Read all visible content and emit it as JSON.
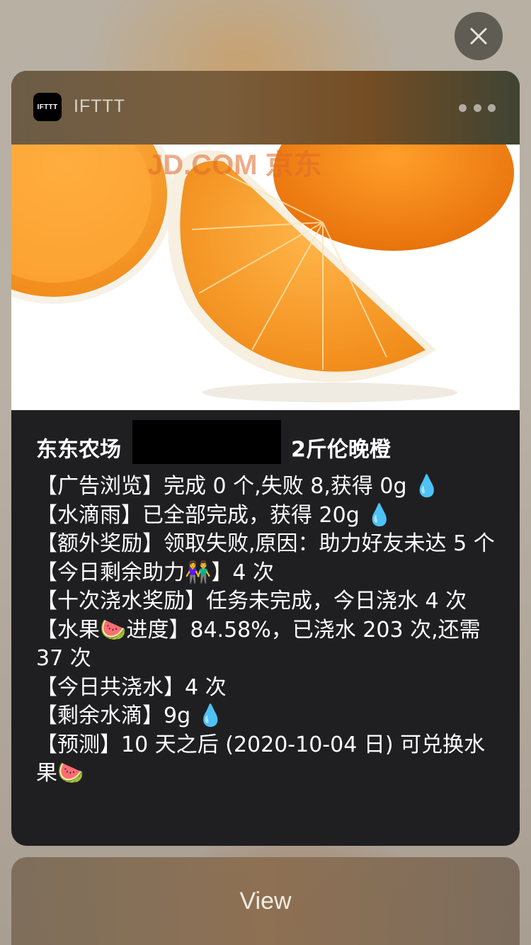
{
  "notification": {
    "app_icon_text": "IFTTT",
    "app_name": "IFTTT",
    "image_watermark": "JD.COM 京东",
    "title_prefix": "东东农场",
    "title_suffix": "2斤伦晚橙",
    "lines": [
      "【广告浏览】完成 0 个,失败 8,获得 0g 💧",
      "【水滴雨】已全部完成，获得 20g 💧",
      "【额外奖励】领取失败,原因：助力好友未达 5 个",
      "【今日剩余助力👫】4 次",
      "【十次浇水奖励】任务未完成，今日浇水 4 次",
      "【水果🍉进度】84.58%，已浇水 203 次,还需 37 次",
      "【今日共浇水】4 次",
      "【剩余水滴】9g 💧",
      "【预测】10 天之后 (2020-10-04 日) 可兑换水果🍉"
    ]
  },
  "actions": {
    "view_label": "View"
  }
}
